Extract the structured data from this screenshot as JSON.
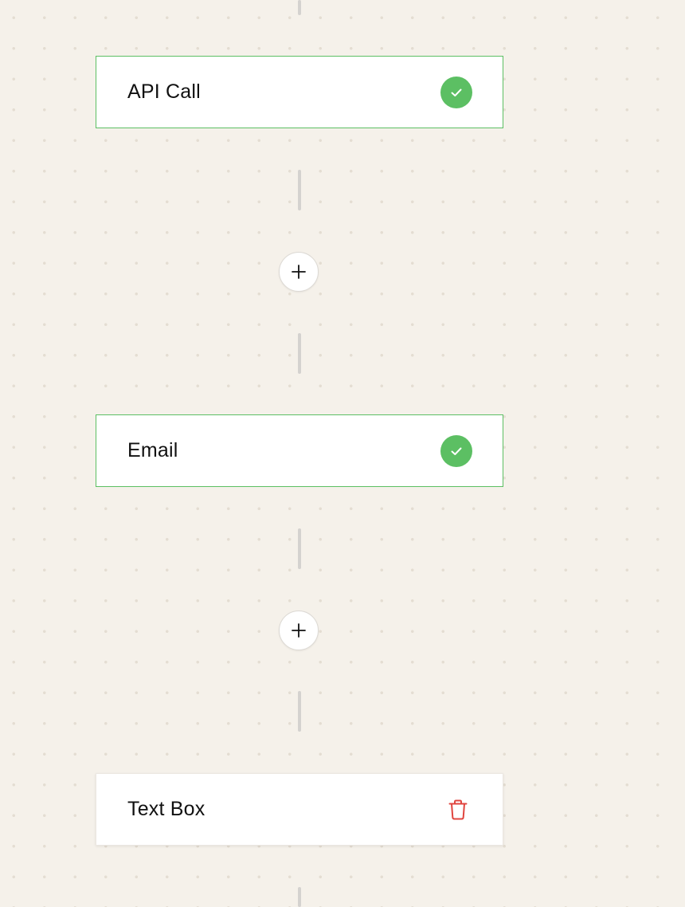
{
  "flow": {
    "nodes": [
      {
        "title": "API Call",
        "status": "valid",
        "icon": "check-circle-icon"
      },
      {
        "title": "Email",
        "status": "valid",
        "icon": "check-circle-icon"
      },
      {
        "title": "Text Box",
        "status": "editing",
        "icon": "trash-icon"
      }
    ],
    "add_step_icon": "plus-icon"
  },
  "colors": {
    "background": "#f5f1ea",
    "success": "#5cbf63",
    "danger": "#e0453f",
    "connector": "#d4d2cf"
  }
}
